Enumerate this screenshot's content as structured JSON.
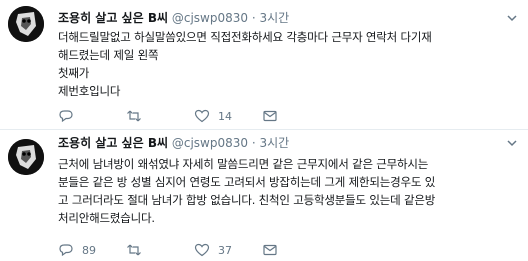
{
  "tweets": [
    {
      "name": "조용히 살고 싶은 B씨",
      "handle": "@cjswp0830",
      "dot": "·",
      "time": "3시간",
      "lines": [
        "더해드릴말없고 하실말씀있으면 직접전화하세요 각층마다 근무자 연락처 다기재",
        "해드렸는데 제일 왼쪽",
        "첫째가",
        "제번호입니다"
      ],
      "actions": {
        "reply": "",
        "retweet": "",
        "like": "14"
      }
    },
    {
      "name": "조용히 살고 싶은 B씨",
      "handle": "@cjswp0830",
      "dot": "·",
      "time": "3시간",
      "lines": [
        "근처에 남녀방이 왜섞였냐 자세히 말씀드리면 같은 근무지에서 같은 근무하시는",
        "분들은 같은 방 성별 심지어 연령도 고려되서 방잡히는데 그게 제한되는경우도 있",
        "고 그러더라도 절대 남녀가 합방 없습니다. 친척인 고등학생분들도 있는데 같은방",
        "처리안해드렸습니다."
      ],
      "actions": {
        "reply": "89",
        "retweet": "",
        "like": "37"
      }
    }
  ],
  "icons": [
    "chevron-down-icon",
    "reply-icon",
    "retweet-icon",
    "like-icon",
    "envelope-icon"
  ],
  "colors": {
    "text": "#14171a",
    "meta": "#657786",
    "border": "#e6ecf0"
  }
}
